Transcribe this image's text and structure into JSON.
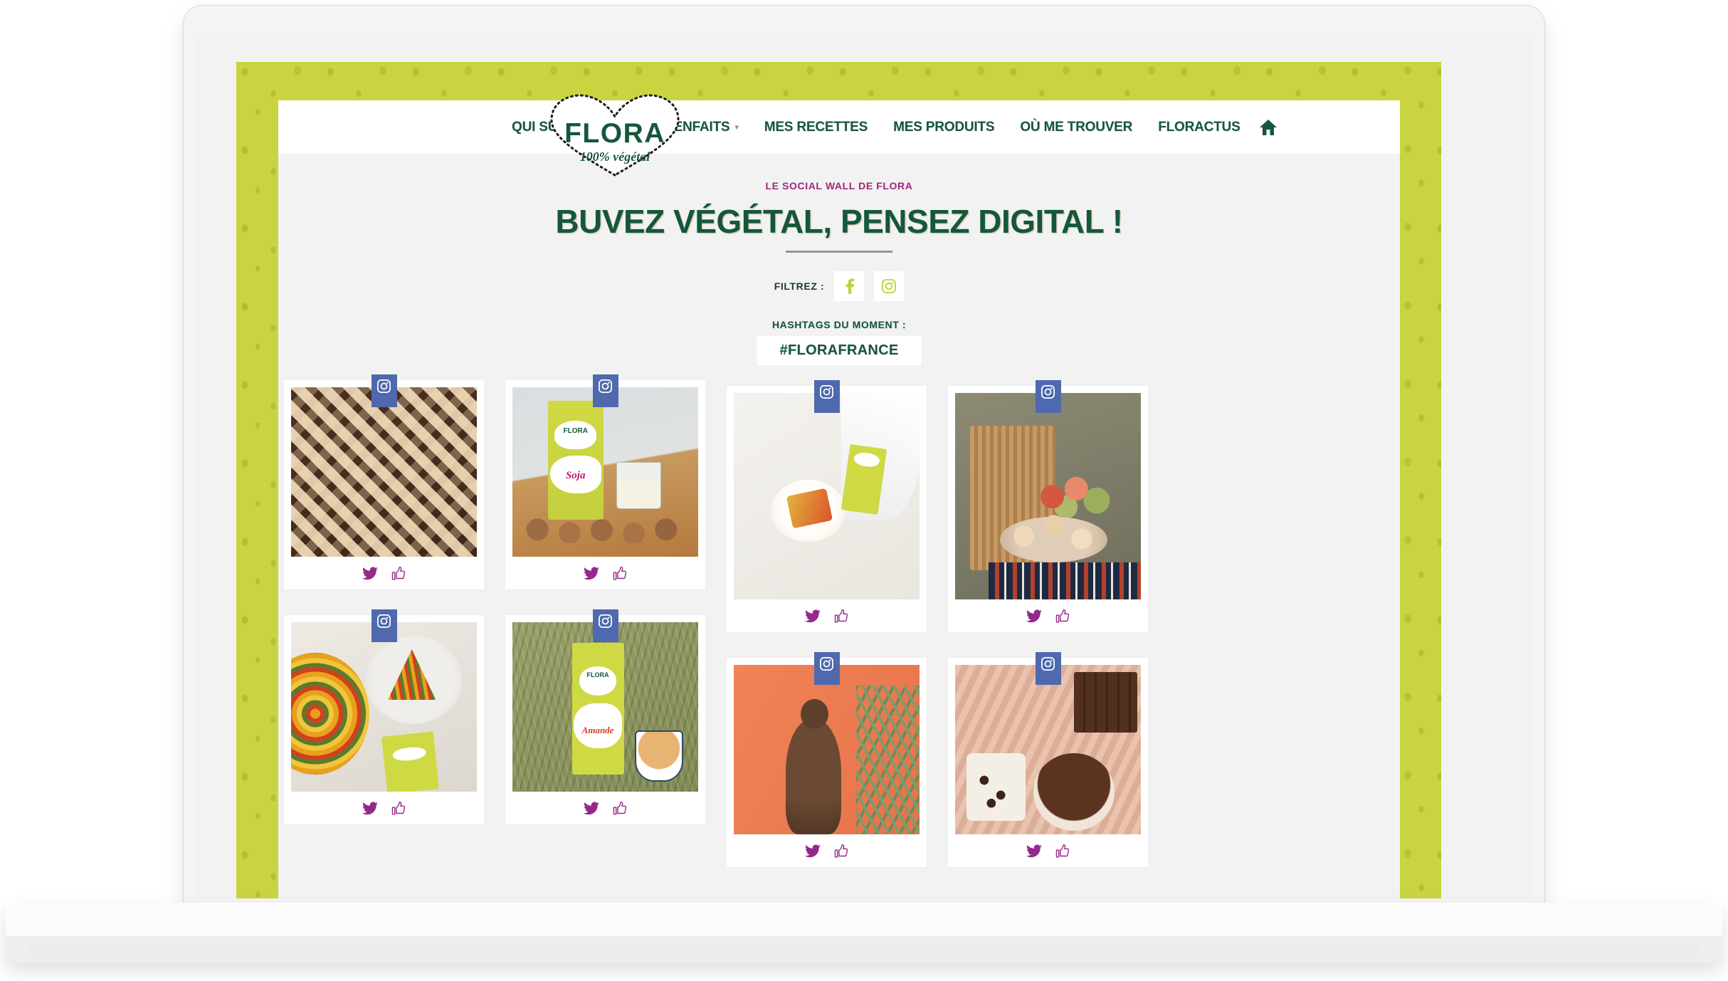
{
  "brand": {
    "logo_word": "FLORA",
    "logo_tagline": "100% végétal",
    "accent_green": "#c9d440",
    "dark_green": "#15573a",
    "magenta": "#a2247e",
    "instagram_badge_blue": "#4f69ae"
  },
  "nav": {
    "items": [
      {
        "label": "QUI SUIS-JE ?",
        "has_dropdown": false
      },
      {
        "label": "MES BIENFAITS",
        "has_dropdown": true
      },
      {
        "label": "MES RECETTES",
        "has_dropdown": false
      },
      {
        "label": "MES PRODUITS",
        "has_dropdown": false
      },
      {
        "label": "OÙ ME TROUVER",
        "has_dropdown": false
      },
      {
        "label": "FLORACTUS",
        "has_dropdown": false
      }
    ],
    "home_icon": "home-icon"
  },
  "hero": {
    "eyebrow": "LE SOCIAL WALL DE FLORA",
    "title": "BUVEZ VÉGÉTAL, PENSEZ DIGITAL !"
  },
  "filters": {
    "label": "FILTREZ :",
    "buttons": [
      {
        "name": "facebook",
        "icon": "facebook-icon"
      },
      {
        "name": "instagram",
        "icon": "instagram-icon"
      }
    ]
  },
  "hashtags": {
    "label": "HASHTAGS DU MOMENT :",
    "chips": [
      "#FLORAFRANCE"
    ]
  },
  "social_wall": {
    "columns": [
      {
        "posts": [
          {
            "source_icon": "instagram-icon",
            "media": "waffles-photo",
            "actions": [
              "twitter-icon",
              "thumbs-up-icon"
            ]
          },
          {
            "source_icon": "instagram-icon",
            "media": "vegetable-tart-photo",
            "actions": [
              "twitter-icon",
              "thumbs-up-icon"
            ]
          }
        ]
      },
      {
        "posts": [
          {
            "source_icon": "instagram-icon",
            "media": "flora-soja-carton-cookies-photo",
            "actions": [
              "twitter-icon",
              "thumbs-up-icon"
            ]
          },
          {
            "source_icon": "instagram-icon",
            "media": "flora-amande-carton-grass-photo",
            "actions": [
              "twitter-icon",
              "thumbs-up-icon"
            ]
          }
        ]
      },
      {
        "posts": [
          {
            "source_icon": "instagram-icon",
            "media": "waffle-flatlay-soja-photo",
            "actions": [
              "twitter-icon",
              "thumbs-up-icon"
            ]
          },
          {
            "source_icon": "instagram-icon",
            "media": "woman-orange-wall-photo",
            "actions": [
              "twitter-icon",
              "thumbs-up-icon"
            ]
          }
        ]
      },
      {
        "posts": [
          {
            "source_icon": "instagram-icon",
            "media": "picnic-basket-muffins-photo",
            "actions": [
              "twitter-icon",
              "thumbs-up-icon"
            ]
          },
          {
            "source_icon": "instagram-icon",
            "media": "knit-blanket-chocolate-photo",
            "actions": [
              "twitter-icon",
              "thumbs-up-icon"
            ]
          }
        ]
      }
    ]
  }
}
